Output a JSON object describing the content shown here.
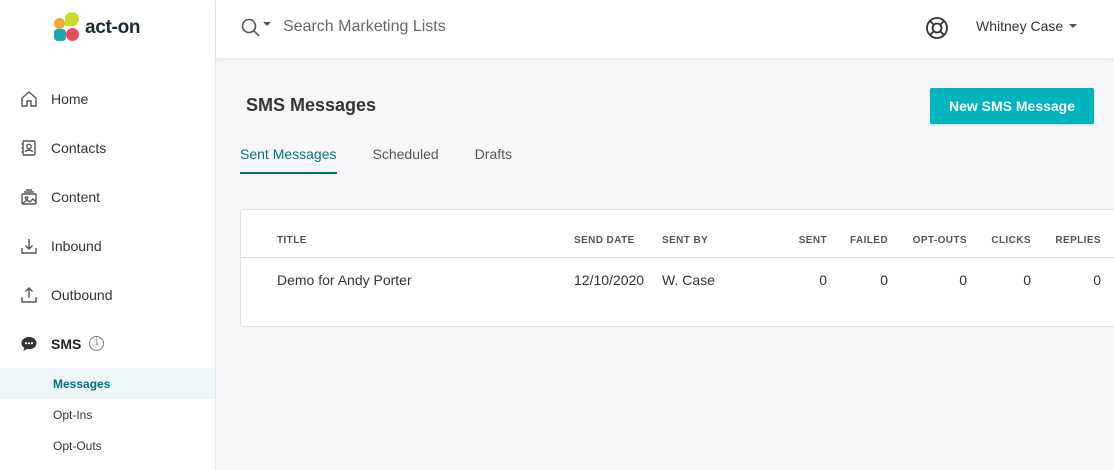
{
  "brand": {
    "name": "act-on"
  },
  "sidebar": {
    "items": [
      {
        "label": "Home",
        "icon": "home-icon"
      },
      {
        "label": "Contacts",
        "icon": "contacts-icon"
      },
      {
        "label": "Content",
        "icon": "content-icon"
      },
      {
        "label": "Inbound",
        "icon": "inbound-icon"
      },
      {
        "label": "Outbound",
        "icon": "outbound-icon"
      },
      {
        "label": "SMS",
        "icon": "sms-icon"
      }
    ],
    "sms_info": "i",
    "sub_items": [
      {
        "label": "Messages",
        "active": true
      },
      {
        "label": "Opt-Ins"
      },
      {
        "label": "Opt-Outs"
      }
    ]
  },
  "topbar": {
    "search_placeholder": "Search Marketing Lists",
    "user_name": "Whitney Case"
  },
  "main": {
    "title": "SMS Messages",
    "new_button": "New SMS Message",
    "tabs": [
      {
        "label": "Sent Messages",
        "active": true
      },
      {
        "label": "Scheduled"
      },
      {
        "label": "Drafts"
      }
    ],
    "table": {
      "columns": [
        "TITLE",
        "SEND DATE",
        "SENT BY",
        "SENT",
        "FAILED",
        "OPT-OUTS",
        "CLICKS",
        "REPLIES"
      ],
      "rows": [
        {
          "title": "Demo for Andy Porter",
          "send_date": "12/10/2020",
          "sent_by": "W. Case",
          "sent": "0",
          "failed": "0",
          "opt_outs": "0",
          "clicks": "0",
          "replies": "0"
        }
      ]
    }
  },
  "colors": {
    "accent": "#00b4bd",
    "active_text": "#00757c",
    "active_bg": "#eef6f7"
  }
}
